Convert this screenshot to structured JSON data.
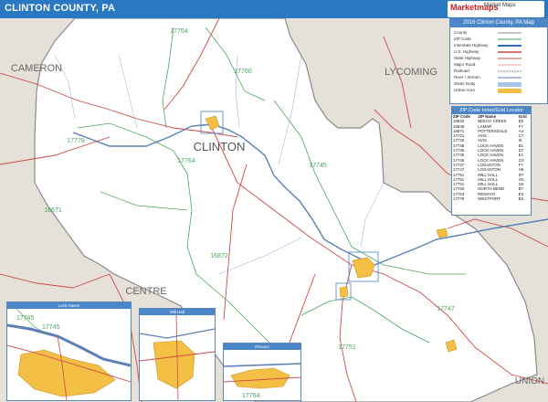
{
  "header": {
    "title": "CLINTON COUNTY, PA",
    "logo_mark": "Marketmaps",
    "logo_sub": "Market Maps"
  },
  "map": {
    "county_label": "CLINTON",
    "neighbors": [
      "CAMERON",
      "LYCOMING",
      "CENTRE",
      "UNION"
    ],
    "zip_labels": [
      "17764",
      "17760",
      "17778",
      "16671",
      "17764",
      "17745",
      "16872",
      "17747",
      "17751",
      "17745"
    ],
    "colors": {
      "county_fill": "#ffffff",
      "neighbor_fill": "#e5e1d8",
      "urban_fill": "#f3bf45",
      "zip_border": "#4aa55a",
      "road": "#d04848",
      "river": "#5b7fb6"
    }
  },
  "legend": {
    "title": "2016 Clinton County, PA Map",
    "rows": [
      "County",
      "ZIP Code",
      "Interstate Highway",
      "U.S. Highway",
      "State Highway",
      "Major Road",
      "Railroad",
      "River / Stream",
      "Water Body",
      "Urban Area"
    ]
  },
  "zip_locator": {
    "title": "ZIP Code Index/Grid Locator",
    "headers": [
      "ZIP Code",
      "ZIP Name",
      "Grid"
    ],
    "rows": [
      [
        "16822",
        "BEECH CREEK",
        "E5"
      ],
      [
        "16848",
        "LAMAR",
        "F7"
      ],
      [
        "16871",
        "POTTERSDALE",
        "A4"
      ],
      [
        "17721",
        "AVIS",
        "C7"
      ],
      [
        "17726",
        "AVIS",
        "I5"
      ],
      [
        "17745",
        "LOCK HAVEN",
        "B1"
      ],
      [
        "17745",
        "LOCK HAVEN",
        "D7"
      ],
      [
        "17745",
        "LOCK HAVEN",
        "E1"
      ],
      [
        "17745",
        "LOCK HAVEN",
        "G3"
      ],
      [
        "17747",
        "LOGANTON",
        "F7"
      ],
      [
        "17747",
        "LOGANTON",
        "H6"
      ],
      [
        "17751",
        "MILL HALL",
        "D7"
      ],
      [
        "17751",
        "MILL HALL",
        "G5"
      ],
      [
        "17751",
        "MILL HALL",
        "G6"
      ],
      [
        "17760",
        "NORTH BEND",
        "B7"
      ],
      [
        "17764",
        "RENOVO",
        "E3"
      ],
      [
        "17778",
        "WESTPORT",
        "B3"
      ]
    ]
  },
  "insets": {
    "lock_haven": {
      "title": "Lock Haven",
      "zip_a": "17745",
      "zip_b": "17745"
    },
    "mill_hall": {
      "title": "Mill Hall"
    },
    "renovo": {
      "title": "Renovo",
      "zip_a": "17764"
    }
  }
}
